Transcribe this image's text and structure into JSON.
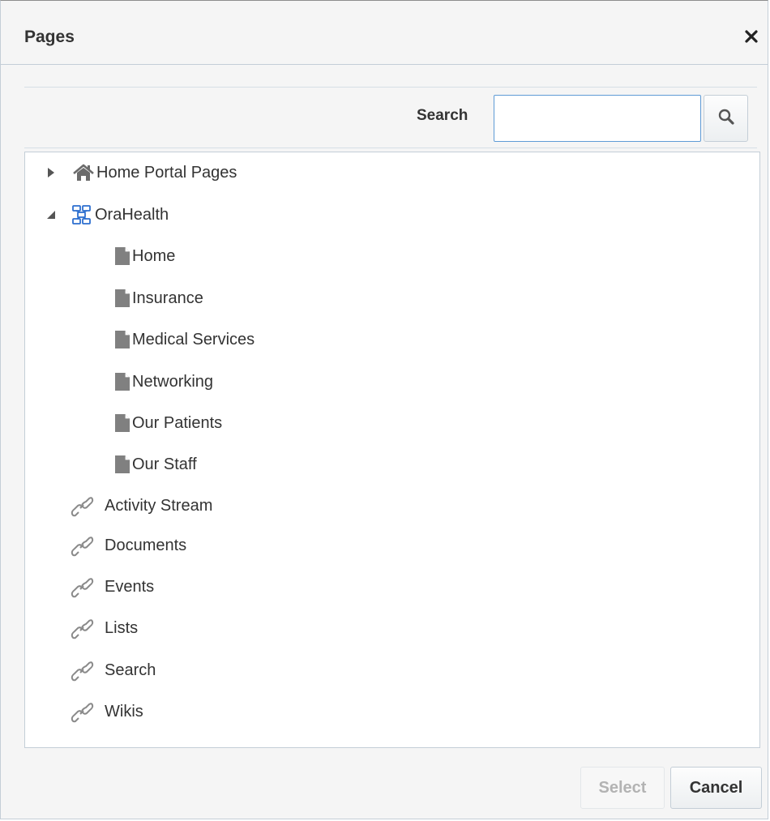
{
  "dialog": {
    "title": "Pages",
    "close_icon": "close-icon"
  },
  "search": {
    "label": "Search",
    "value": "",
    "placeholder": "",
    "button_icon": "magnifier-icon"
  },
  "tree": {
    "nodes": [
      {
        "label": "Home Portal Pages",
        "icon": "home-icon",
        "expander": "collapsed"
      },
      {
        "label": "OraHealth",
        "icon": "portal-icon",
        "expander": "expanded"
      },
      {
        "label": "Home",
        "icon": "page-icon"
      },
      {
        "label": "Insurance",
        "icon": "page-icon"
      },
      {
        "label": "Medical Services",
        "icon": "page-icon"
      },
      {
        "label": "Networking",
        "icon": "page-icon"
      },
      {
        "label": "Our Patients",
        "icon": "page-icon"
      },
      {
        "label": "Our Staff",
        "icon": "page-icon"
      },
      {
        "label": "Activity Stream",
        "icon": "link-icon"
      },
      {
        "label": "Documents",
        "icon": "link-icon"
      },
      {
        "label": "Events",
        "icon": "link-icon"
      },
      {
        "label": "Lists",
        "icon": "link-icon"
      },
      {
        "label": "Search",
        "icon": "link-icon"
      },
      {
        "label": "Wikis",
        "icon": "link-icon"
      }
    ]
  },
  "footer": {
    "select_label": "Select",
    "select_enabled": false,
    "cancel_label": "Cancel"
  },
  "colors": {
    "panel_bg": "#f5f5f5",
    "border": "#c4ced7",
    "input_focus_border": "#5f9bd6",
    "icon_gray": "#808080",
    "portal_blue": "#2d6fcf",
    "disabled_text": "#b3b3b3"
  }
}
